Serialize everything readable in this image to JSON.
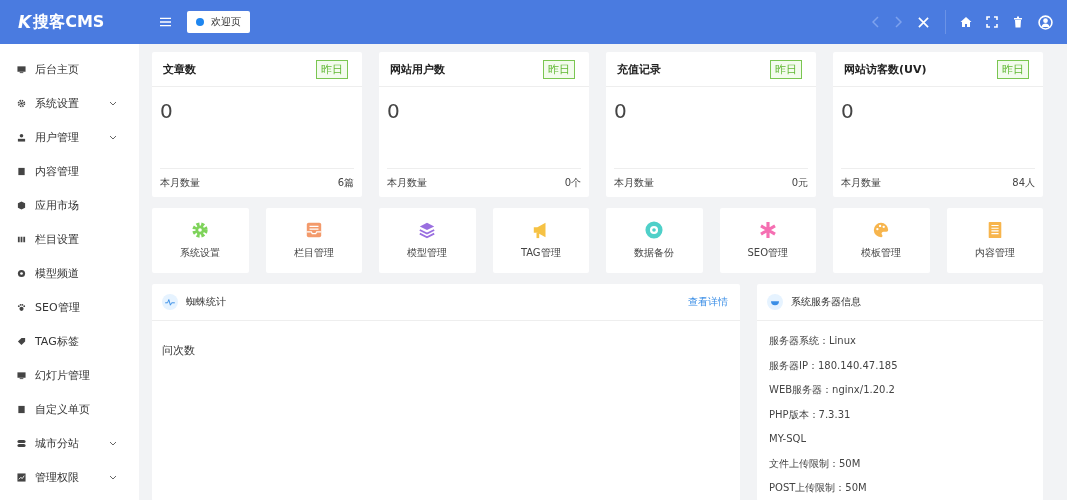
{
  "header": {
    "logo_mark": "K",
    "logo_text": "搜客CMS",
    "tab": {
      "label": "欢迎页",
      "selected": true
    }
  },
  "sidebar": {
    "items": [
      {
        "label": "后台主页",
        "kind": "monitor",
        "expandable": false
      },
      {
        "label": "系统设置",
        "kind": "gear",
        "expandable": true
      },
      {
        "label": "用户管理",
        "kind": "user",
        "expandable": true
      },
      {
        "label": "内容管理",
        "kind": "book",
        "expandable": false
      },
      {
        "label": "应用市场",
        "kind": "cube",
        "expandable": false
      },
      {
        "label": "栏目设置",
        "kind": "columns",
        "expandable": false
      },
      {
        "label": "模型频道",
        "kind": "circle",
        "expandable": false
      },
      {
        "label": "SEO管理",
        "kind": "paw",
        "expandable": false
      },
      {
        "label": "TAG标签",
        "kind": "tag",
        "expandable": false
      },
      {
        "label": "幻灯片管理",
        "kind": "monitor",
        "expandable": false
      },
      {
        "label": "自定义单页",
        "kind": "book",
        "expandable": false
      },
      {
        "label": "城市分站",
        "kind": "toggle",
        "expandable": true
      },
      {
        "label": "管理权限",
        "kind": "chart",
        "expandable": true
      }
    ]
  },
  "stats": [
    {
      "title": "文章数",
      "badge": "昨日",
      "value": "0",
      "footer_label": "本月数量",
      "footer_value": "6篇"
    },
    {
      "title": "网站用户数",
      "badge": "昨日",
      "value": "0",
      "footer_label": "本月数量",
      "footer_value": "0个"
    },
    {
      "title": "充值记录",
      "badge": "昨日",
      "value": "0",
      "footer_label": "本月数量",
      "footer_value": "0元"
    },
    {
      "title": "网站访客数(UV)",
      "badge": "昨日",
      "value": "0",
      "footer_label": "本月数量",
      "footer_value": "84人"
    }
  ],
  "shortcuts": [
    {
      "label": "系统设置",
      "kind": "gear",
      "color": "#7ed35a"
    },
    {
      "label": "栏目管理",
      "kind": "inbox",
      "color": "#f39a6b"
    },
    {
      "label": "模型管理",
      "kind": "layers",
      "color": "#9a6fe0"
    },
    {
      "label": "TAG管理",
      "kind": "megaphone",
      "color": "#f6c244"
    },
    {
      "label": "数据备份",
      "kind": "ring",
      "color": "#4fd0c9"
    },
    {
      "label": "SEO管理",
      "kind": "asterisk",
      "color": "#f56fb2"
    },
    {
      "label": "模板管理",
      "kind": "palette",
      "color": "#f7b54d"
    },
    {
      "label": "内容管理",
      "kind": "document",
      "color": "#f7b54d"
    }
  ],
  "spider_panel": {
    "title": "蜘蛛统计",
    "link": "查看详情",
    "axis_label": "问次数"
  },
  "server_panel": {
    "title": "系统服务器信息",
    "lines": [
      "服务器系统：Linux",
      "服务器IP：180.140.47.185",
      "WEB服务器：nginx/1.20.2",
      "PHP版本：7.3.31",
      "MY-SQL",
      "文件上传限制：50M",
      "POST上传限制：50M"
    ]
  }
}
